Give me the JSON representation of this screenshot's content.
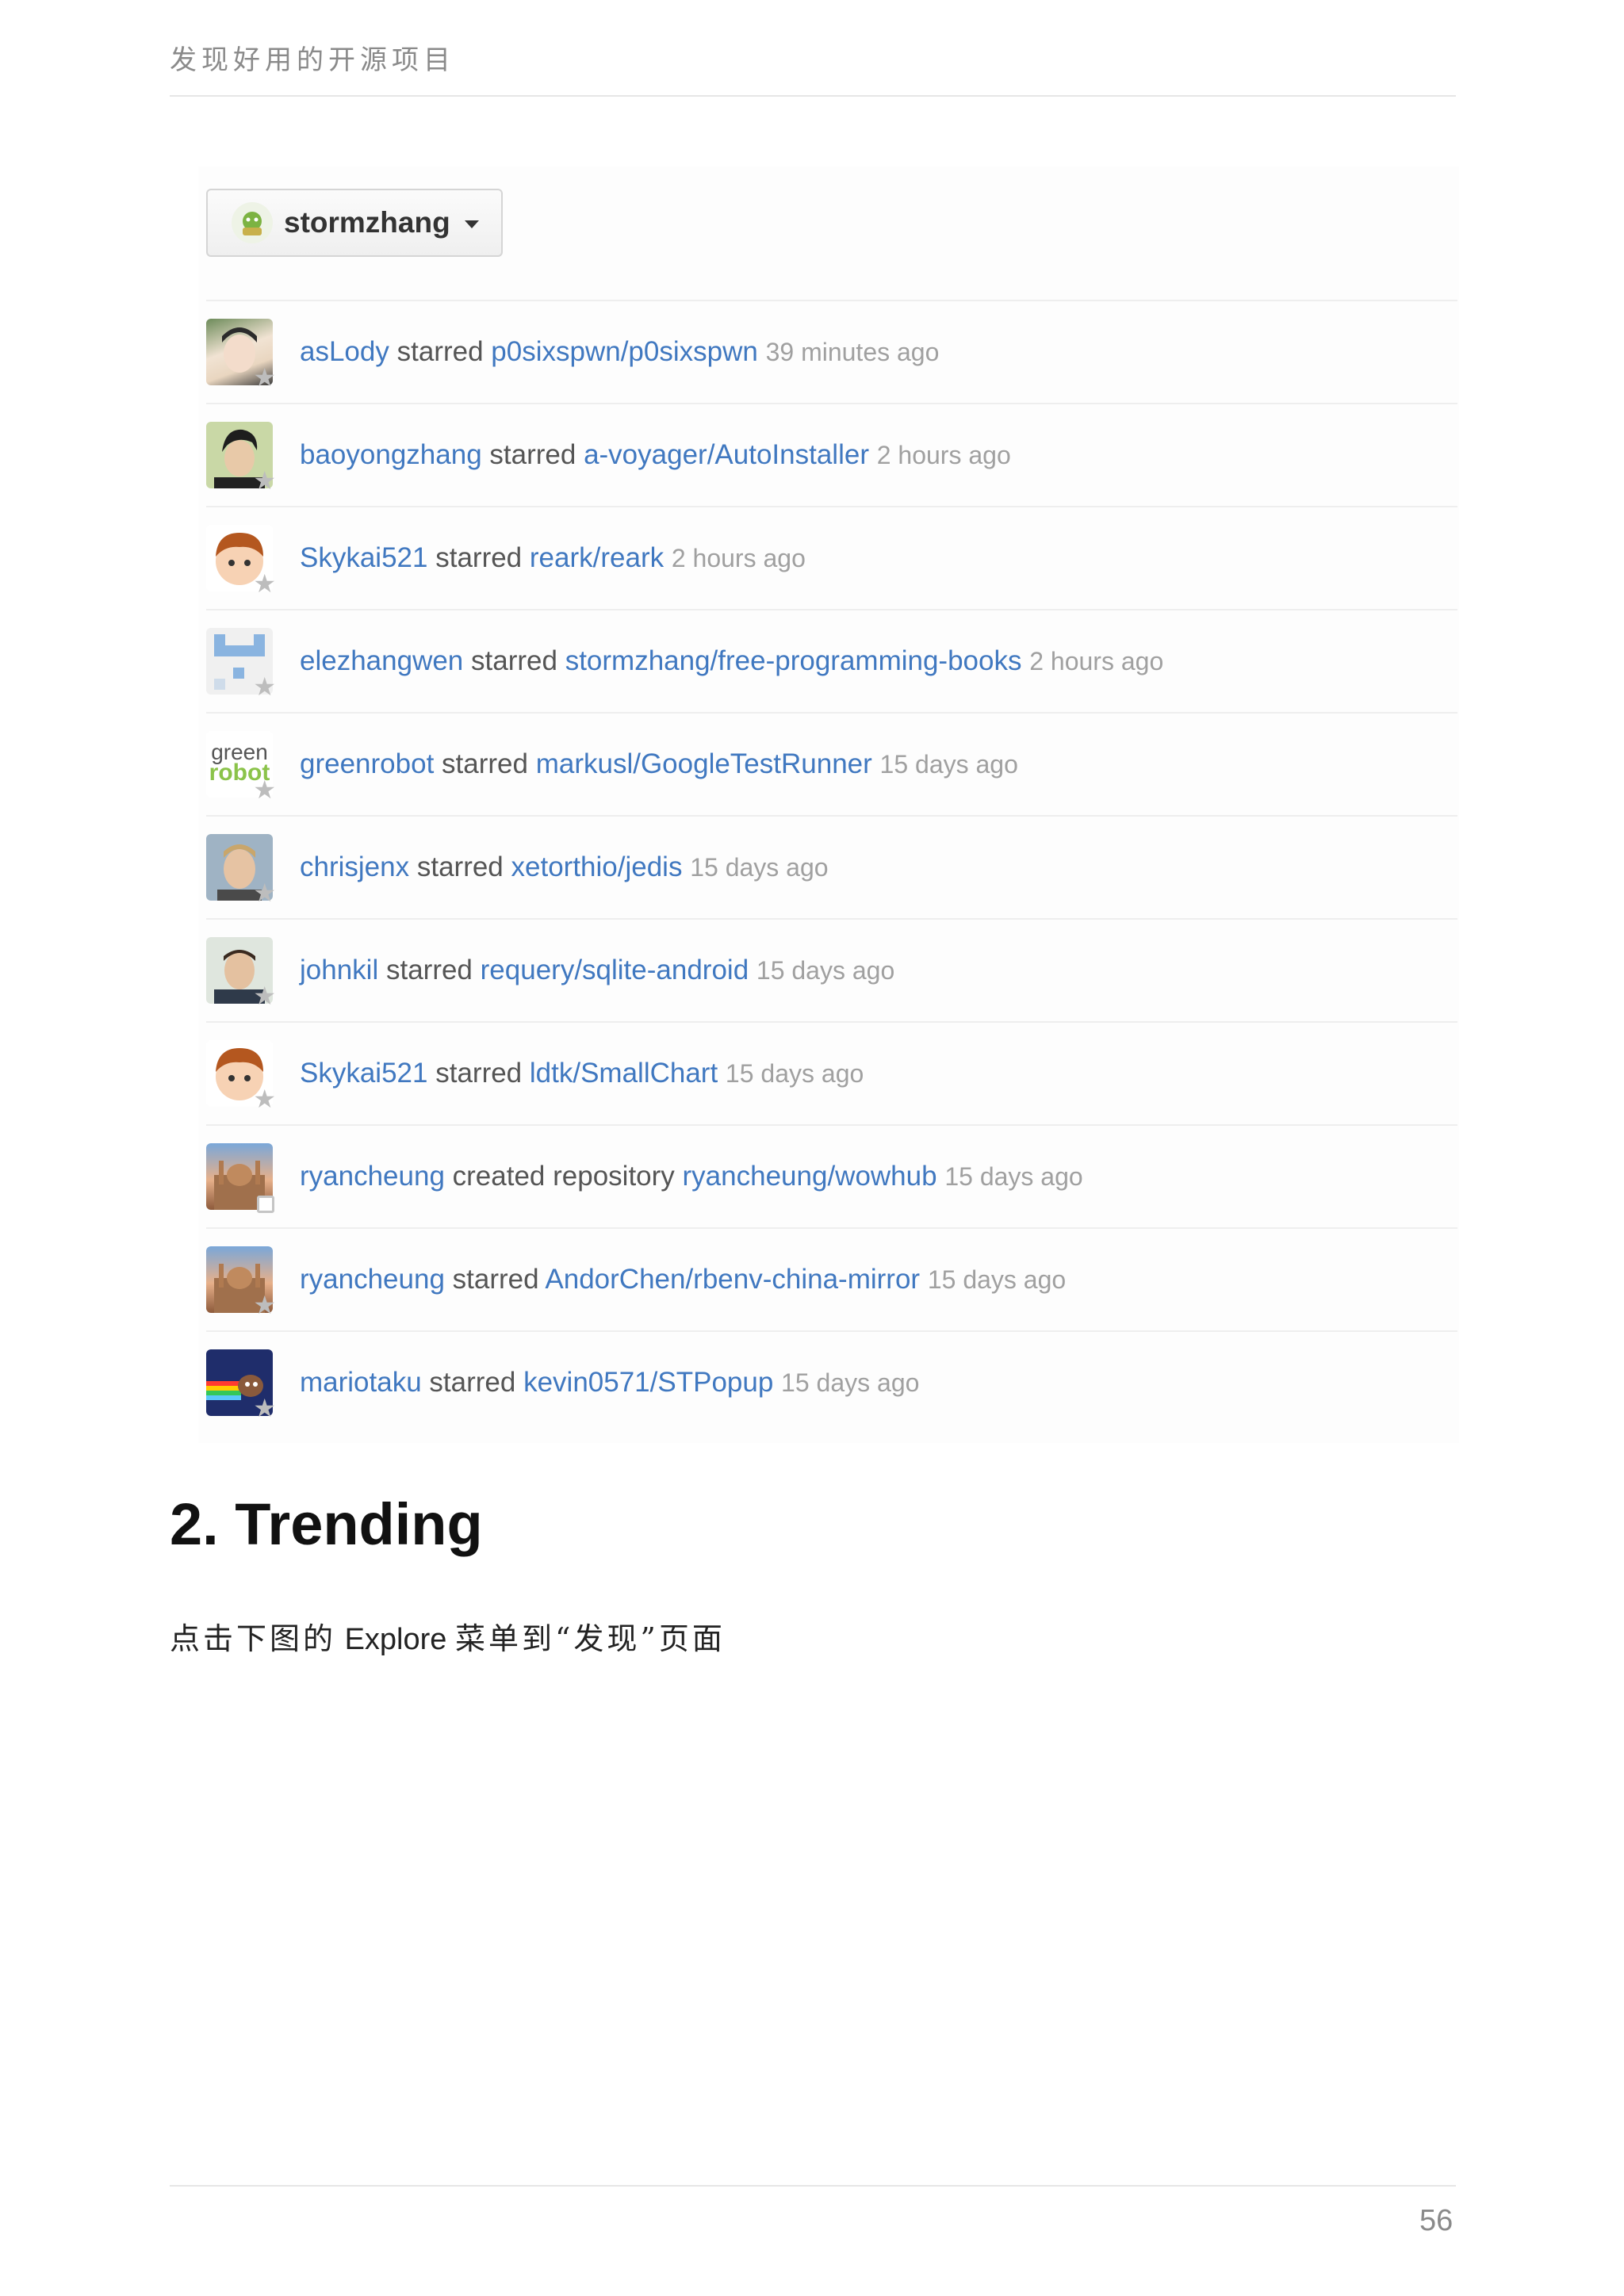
{
  "page_header": "发现好用的开源项目",
  "account_switcher": {
    "name": "stormzhang"
  },
  "feed": [
    {
      "user": "asLody",
      "verb": "starred",
      "repo": "p0sixspwn/p0sixspwn",
      "time": "39 minutes ago",
      "icon": "star-icon"
    },
    {
      "user": "baoyongzhang",
      "verb": "starred",
      "repo": "a-voyager/AutoInstaller",
      "time": "2 hours ago",
      "icon": "star-icon"
    },
    {
      "user": "Skykai521",
      "verb": "starred",
      "repo": "reark/reark",
      "time": "2 hours ago",
      "icon": "star-icon"
    },
    {
      "user": "elezhangwen",
      "verb": "starred",
      "repo": "stormzhang/free-programming-books",
      "time": "2 hours ago",
      "icon": "star-icon"
    },
    {
      "user": "greenrobot",
      "verb": "starred",
      "repo": "markusl/GoogleTestRunner",
      "time": "15 days ago",
      "icon": "star-icon",
      "avatar_text": [
        "green",
        "robot"
      ]
    },
    {
      "user": "chrisjenx",
      "verb": "starred",
      "repo": "xetorthio/jedis",
      "time": "15 days ago",
      "icon": "star-icon"
    },
    {
      "user": "johnkil",
      "verb": "starred",
      "repo": "requery/sqlite-android",
      "time": "15 days ago",
      "icon": "star-icon"
    },
    {
      "user": "Skykai521",
      "verb": "starred",
      "repo": "ldtk/SmallChart",
      "time": "15 days ago",
      "icon": "star-icon"
    },
    {
      "user": "ryancheung",
      "verb": "created repository",
      "repo": "ryancheung/wowhub",
      "time": "15 days ago",
      "icon": "repo-icon"
    },
    {
      "user": "ryancheung",
      "verb": "starred",
      "repo": "AndorChen/rbenv-china-mirror",
      "time": "15 days ago",
      "icon": "star-icon"
    },
    {
      "user": "mariotaku",
      "verb": "starred",
      "repo": "kevin0571/STPopup",
      "time": "15 days ago",
      "icon": "star-icon"
    }
  ],
  "section_title": "2. Trending",
  "body": {
    "prefix": "点击下图的",
    "link": "Explore",
    "suffix": "菜单到“发现”页面"
  },
  "page_number": "56"
}
